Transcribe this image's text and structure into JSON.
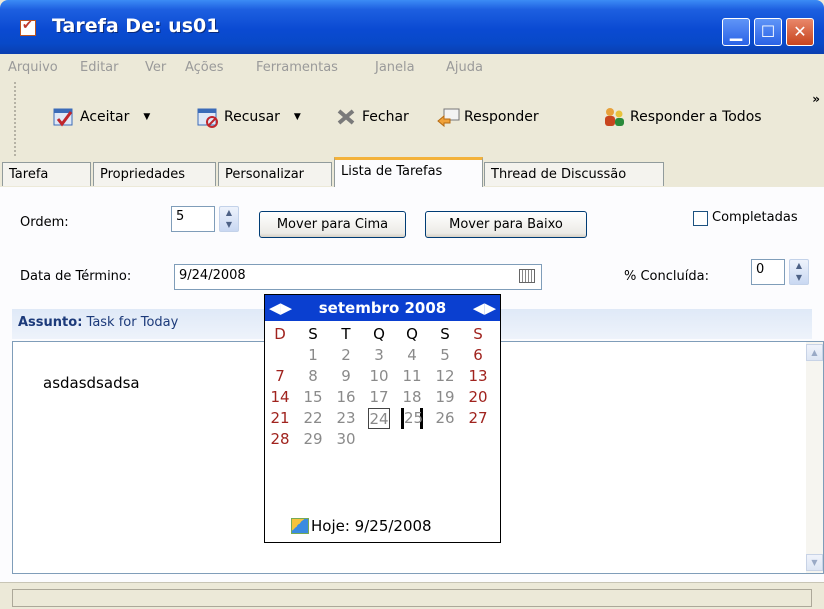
{
  "window": {
    "title": "Tarefa De: us01"
  },
  "menu": [
    "Arquivo",
    "Editar",
    "Ver",
    "Ações",
    "Ferramentas",
    "Janela",
    "Ajuda"
  ],
  "toolbar": {
    "accept": "Aceitar",
    "decline": "Recusar",
    "close": "Fechar",
    "reply": "Responder",
    "reply_all": "Responder a Todos",
    "more": "»"
  },
  "tabs": [
    "Tarefa",
    "Propriedades",
    "Personalizar",
    "Lista de Tarefas",
    "Thread de Discussão"
  ],
  "active_tab": "Lista de Tarefas",
  "form": {
    "order_label": "Ordem:",
    "order_value": "5",
    "move_up": "Mover para Cima",
    "move_down": "Mover para Baixo",
    "completed_label": "Completadas",
    "completed_checked": false,
    "due_label": "Data de Término:",
    "due_value": "9/24/2008",
    "percent_label": "% Concluída:",
    "percent_value": "0",
    "subject_label": "Assunto:",
    "subject_value": "Task for Today",
    "body_text": "asdasdsadsa"
  },
  "calendar": {
    "month_title": "setembro 2008",
    "weekdays": [
      "D",
      "S",
      "T",
      "Q",
      "Q",
      "S",
      "S"
    ],
    "weeks": [
      [
        "",
        "1",
        "2",
        "3",
        "4",
        "5",
        "6"
      ],
      [
        "7",
        "8",
        "9",
        "10",
        "11",
        "12",
        "13"
      ],
      [
        "14",
        "15",
        "16",
        "17",
        "18",
        "19",
        "20"
      ],
      [
        "21",
        "22",
        "23",
        "24",
        "25",
        "26",
        "27"
      ],
      [
        "28",
        "29",
        "30",
        "",
        "",
        "",
        ""
      ]
    ],
    "selected_day": "24",
    "today_day": "25",
    "today_label": "Hoje: 9/25/2008"
  },
  "colors": {
    "titlebar": "#0a4ad2",
    "calendar_header": "#0a3fd0",
    "weekend": "#a0231e",
    "active_tab_accent": "#f3b23b"
  }
}
